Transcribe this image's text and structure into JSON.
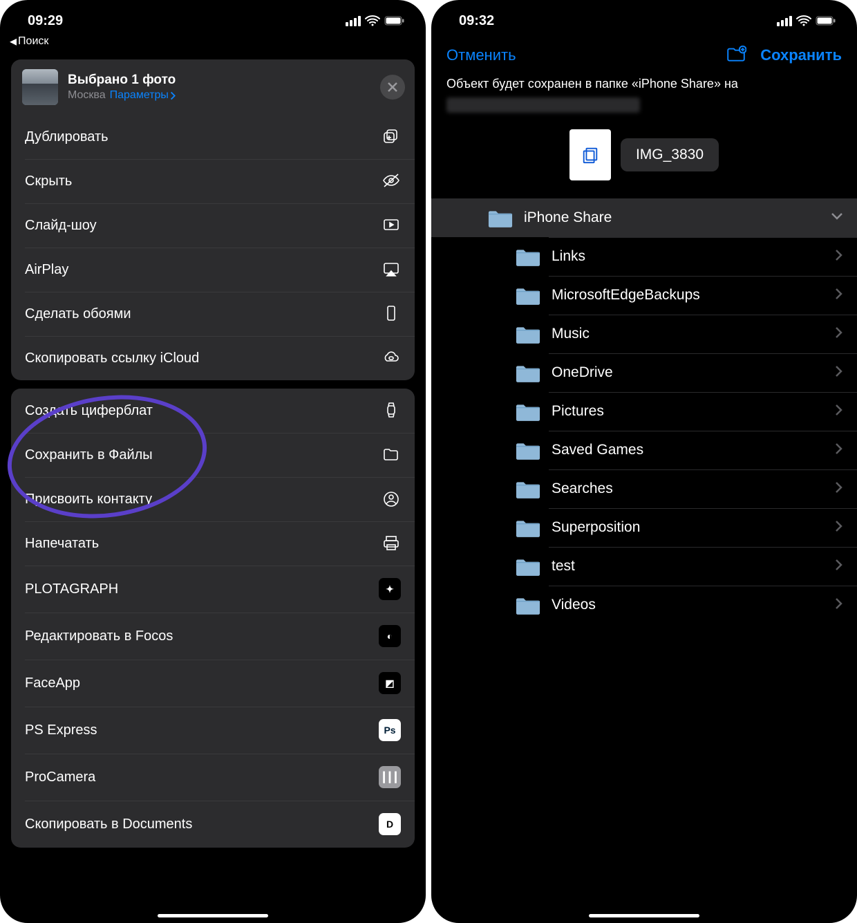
{
  "left": {
    "status": {
      "time": "09:29"
    },
    "breadcrumb": "Поиск",
    "share_header": {
      "title": "Выбрано 1 фото",
      "location": "Москва",
      "params": "Параметры"
    },
    "group1": [
      {
        "label": "Дублировать",
        "icon": "duplicate"
      },
      {
        "label": "Скрыть",
        "icon": "eye-slash"
      },
      {
        "label": "Слайд-шоу",
        "icon": "play-rect"
      },
      {
        "label": "AirPlay",
        "icon": "airplay"
      },
      {
        "label": "Сделать обоями",
        "icon": "phone-rect"
      },
      {
        "label": "Скопировать ссылку iCloud",
        "icon": "icloud-link"
      }
    ],
    "group2": [
      {
        "label": "Создать циферблат",
        "icon": "watch"
      },
      {
        "label": "Сохранить в Файлы",
        "icon": "folder"
      },
      {
        "label": "Присвоить контакту",
        "icon": "person-circle"
      },
      {
        "label": "Напечатать",
        "icon": "printer"
      },
      {
        "label": "PLOTAGRAPH",
        "icon": "app-plotagraph"
      },
      {
        "label": "Редактировать в Focos",
        "icon": "app-focos"
      },
      {
        "label": "FaceApp",
        "icon": "app-faceapp"
      },
      {
        "label": "PS Express",
        "icon": "app-ps"
      },
      {
        "label": "ProCamera",
        "icon": "app-procamera"
      },
      {
        "label": "Скопировать в Documents",
        "icon": "app-documents"
      }
    ]
  },
  "right": {
    "status": {
      "time": "09:32"
    },
    "nav": {
      "cancel": "Отменить",
      "save": "Сохранить"
    },
    "save_msg": "Объект будет сохранен в папке «iPhone Share» на",
    "file_name": "IMG_3830",
    "selected_folder": "iPhone Share",
    "folders": [
      "Links",
      "MicrosoftEdgeBackups",
      "Music",
      "OneDrive",
      "Pictures",
      "Saved Games",
      "Searches",
      "Superposition",
      "test",
      "Videos"
    ]
  }
}
